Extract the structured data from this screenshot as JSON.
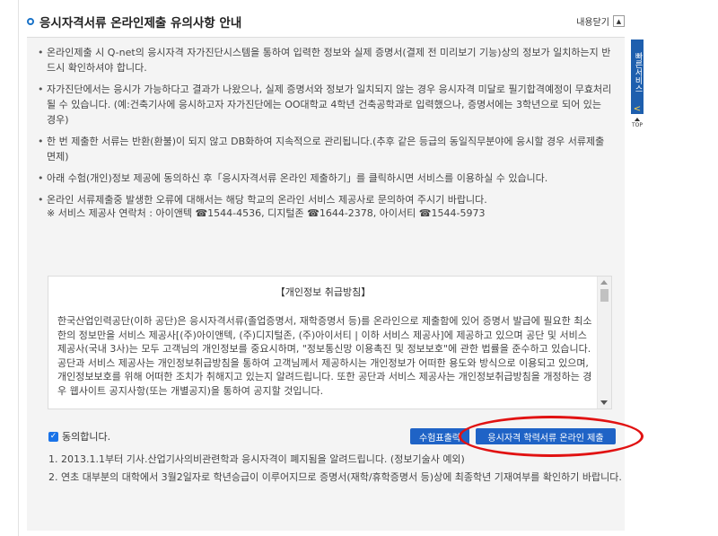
{
  "header": {
    "title": "응시자격서류 온라인제출 유의사항 안내",
    "collapse_label": "내용닫기",
    "collapse_icon": "chevron-up-icon"
  },
  "notices": [
    "온라인제출 시 Q-net의 응시자격 자가진단시스템을 통하여 입력한 정보와 실제 증명서(결제 전 미리보기 기능)상의 정보가 일치하는지 반드시 확인하셔야 합니다.",
    "자가진단에서는 응시가 가능하다고 결과가 나왔으나, 실제 증명서와 정보가 일치되지 않는 경우 응시자격 미달로 필기합격예정이 무효처리 될 수 있습니다. (예:건축기사에 응시하고자 자가진단에는 OO대학교 4학년 건축공학과로 입력했으나, 증명서에는 3학년으로 되어 있는 경우)",
    "한 번 제출한 서류는 반환(환불)이 되지 않고 DB화하여 지속적으로 관리됩니다.(추후 같은 등급의 동일직무분야에 응시할 경우 서류제출 면제)",
    "아래 수험(개인)정보 제공에 동의하신 후「응시자격서류 온라인 제출하기」를 클릭하시면 서비스를 이용하실 수 있습니다.",
    "온라인 서류제출중 발생한 오류에 대해서는 해당 학교의 온라인 서비스 제공사로 문의하여 주시기 바랍니다."
  ],
  "contacts": {
    "prefix": "※ 서비스 제공사 연락처 : 아이앤텍 ",
    "phone1": "1544-4536",
    "mid1": ", 디지털존 ",
    "phone2": "1644-2378",
    "mid2": ", 아이서티 ",
    "phone3": "1544-5973",
    "phone_glyph": "☎"
  },
  "policy": {
    "title": "【개인정보 취급방침】",
    "body": " 한국산업인력공단(이하 공단)은 응시자격서류(졸업증명서, 재학증명서 등)를 온라인으로 제출함에 있어 증명서 발급에 필요한 최소한의 정보만을 서비스 제공사[(주)아이앤텍, (주)디지털존, (주)아이서티 | 이하 서비스 제공사]에 제공하고 있으며 공단 및 서비스 제공사(국내 3사)는 모두 고객님의 개인정보를 중요시하며, \"정보통신망 이용촉진 및 정보보호\"에 관한 법률을 준수하고 있습니다.\n 공단과 서비스 제공사는 개인정보취급방침을 통하여 고객님께서 제공하시는 개인정보가 어떠한 용도와 방식으로 이용되고 있으며, 개인정보보호를 위해 어떠한 조치가 취해지고 있는지 알려드립니다. 또한 공단과 서비스 제공사는 개인정보취급방침을 개정하는 경우 웹사이트 공지사항(또는 개별공지)을 통하여 공지할 것입니다."
  },
  "agree": {
    "label": "동의합니다.",
    "checked": true
  },
  "buttons": {
    "sample": "수험표출력",
    "submit": "응시자격 학력서류 온라인 제출"
  },
  "notes": [
    "1. 2013.1.1부터 기사.산업기사의비관련학과 응시자격이 폐지됨을 알려드립니다. (정보기술사 예외)",
    "2. 연초 대부분의 대학에서 3월2일자로 학년승급이 이루어지므로 증명서(재학/휴학증명서 등)상에 최종학년 기재여부를 확인하기 바랍니다."
  ],
  "side": {
    "quick_label": "빠른서비스",
    "arrow": "<",
    "top_label": "TOP"
  },
  "colors": {
    "accent": "#1f63c6",
    "highlight": "#e11212"
  }
}
